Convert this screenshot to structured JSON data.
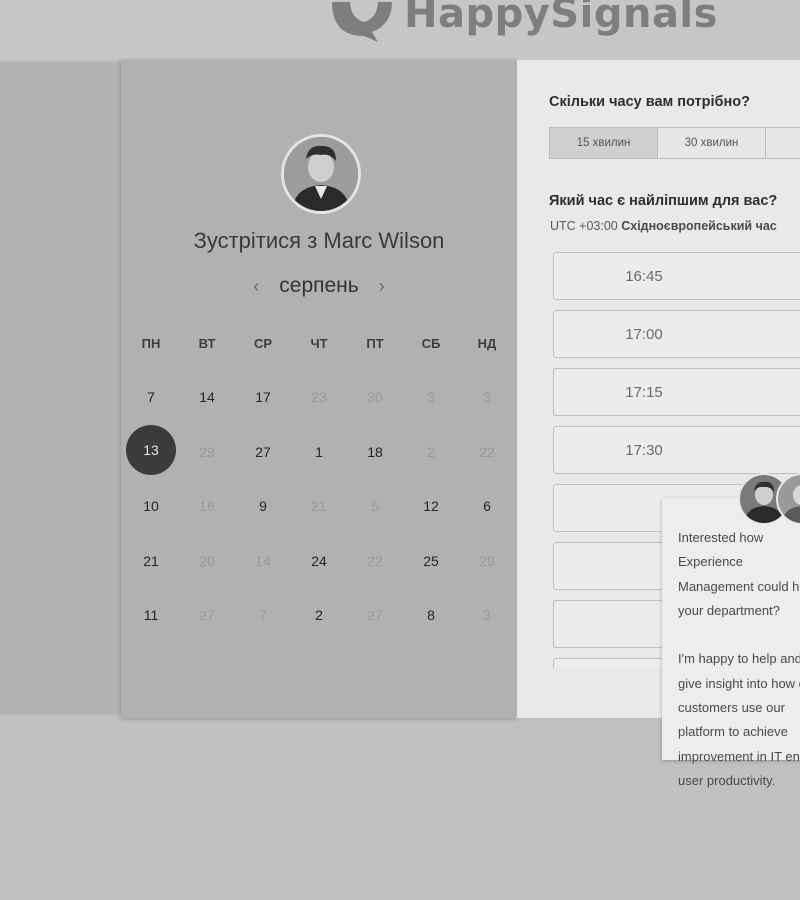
{
  "brand": {
    "name": "HappySignals"
  },
  "calendar": {
    "title_prefix": "Зустрітися з",
    "host_name": "Marc Wilson",
    "month": "серпень",
    "prev_icon": "chevron-left-icon",
    "next_icon": "chevron-right-icon",
    "weekdays": [
      "ПН",
      "ВТ",
      "СР",
      "ЧТ",
      "ПТ",
      "СБ",
      "НД"
    ],
    "weeks": [
      [
        {
          "d": "7",
          "m": false
        },
        {
          "d": "14",
          "m": false
        },
        {
          "d": "17",
          "m": false
        },
        {
          "d": "23",
          "m": true
        },
        {
          "d": "30",
          "m": true
        },
        {
          "d": "3",
          "m": true
        },
        {
          "d": "3",
          "m": true
        }
      ],
      [
        {
          "d": "13",
          "m": false,
          "s": true
        },
        {
          "d": "29",
          "m": true
        },
        {
          "d": "27",
          "m": false
        },
        {
          "d": "1",
          "m": false
        },
        {
          "d": "18",
          "m": false
        },
        {
          "d": "2",
          "m": true
        },
        {
          "d": "22",
          "m": true
        }
      ],
      [
        {
          "d": "10",
          "m": false
        },
        {
          "d": "16",
          "m": true
        },
        {
          "d": "9",
          "m": false
        },
        {
          "d": "21",
          "m": true
        },
        {
          "d": "5",
          "m": true
        },
        {
          "d": "12",
          "m": false
        },
        {
          "d": "6",
          "m": false
        }
      ],
      [
        {
          "d": "21",
          "m": false
        },
        {
          "d": "20",
          "m": true
        },
        {
          "d": "14",
          "m": true
        },
        {
          "d": "24",
          "m": false
        },
        {
          "d": "22",
          "m": true
        },
        {
          "d": "25",
          "m": false
        },
        {
          "d": "29",
          "m": true
        }
      ],
      [
        {
          "d": "11",
          "m": false
        },
        {
          "d": "27",
          "m": true
        },
        {
          "d": "7",
          "m": true
        },
        {
          "d": "2",
          "m": false
        },
        {
          "d": "27",
          "m": true
        },
        {
          "d": "8",
          "m": false
        },
        {
          "d": "3",
          "m": true
        }
      ]
    ]
  },
  "booking": {
    "duration_question": "Скільки часу вам потрібно?",
    "durations": [
      "15 хвилин",
      "30 хвилин"
    ],
    "time_question": "Який час є найліпшим для вас?",
    "timezone_offset": "UTC +03:00",
    "timezone_name": "Східноєвропейський час",
    "slots": [
      "16:45",
      "17:00",
      "17:15",
      "17:30",
      "",
      "",
      "",
      ""
    ]
  },
  "chat": {
    "message": "Interested how Experience Management could help your department?\n\nI'm happy to help and give insight into how our customers use our platform to achieve improvement in IT end-user productivity."
  }
}
